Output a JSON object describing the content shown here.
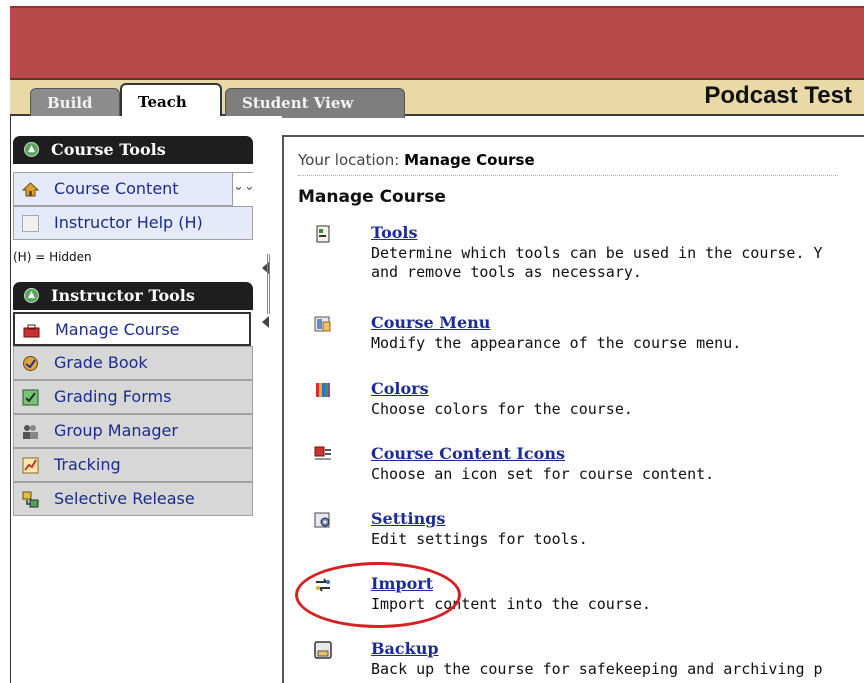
{
  "tabs": [
    {
      "label": "Build"
    },
    {
      "label": "Teach"
    },
    {
      "label": "Student View"
    }
  ],
  "course_title": "Podcast Test",
  "course_tools": {
    "title": "Course Tools",
    "items": [
      {
        "label": "Course Content",
        "icon": "house-icon"
      },
      {
        "label": "Instructor Help (H)",
        "icon": "blank-icon"
      }
    ],
    "hidden_note": "(H) = Hidden"
  },
  "instructor_tools": {
    "title": "Instructor Tools",
    "items": [
      {
        "label": "Manage Course",
        "icon": "toolbox-icon"
      },
      {
        "label": "Grade Book",
        "icon": "gradebook-icon"
      },
      {
        "label": "Grading Forms",
        "icon": "grading-forms-icon"
      },
      {
        "label": "Group Manager",
        "icon": "group-icon"
      },
      {
        "label": "Tracking",
        "icon": "chart-icon"
      },
      {
        "label": "Selective Release",
        "icon": "release-icon"
      }
    ]
  },
  "location": {
    "prefix": "Your location:",
    "value": "Manage Course"
  },
  "heading": "Manage Course",
  "entries": [
    {
      "title": "Tools",
      "desc": "Determine which tools can be used in the course. Y",
      "desc2": "and remove tools as necessary.",
      "icon": "tools-icon"
    },
    {
      "title": "Course Menu",
      "desc": "Modify the appearance of the course menu.",
      "desc2": "",
      "icon": "course-menu-icon"
    },
    {
      "title": "Colors",
      "desc": "Choose colors for the course.",
      "desc2": "",
      "icon": "colors-icon"
    },
    {
      "title": "Course Content Icons",
      "desc": "Choose an icon set for course content.",
      "desc2": "",
      "icon": "content-icons-icon"
    },
    {
      "title": "Settings",
      "desc": "Edit settings for tools.",
      "desc2": "",
      "icon": "settings-icon"
    },
    {
      "title": "Import",
      "desc": "Import content into the course.",
      "desc2": "",
      "icon": "import-icon"
    },
    {
      "title": "Backup",
      "desc": "Back up the course for safekeeping and archiving p",
      "desc2": "",
      "icon": "backup-icon"
    }
  ],
  "colors": {
    "banner": "#b94a4a",
    "tabbar": "#e8d9a6",
    "link": "#1b2b9a",
    "highlight": "#d42222"
  }
}
